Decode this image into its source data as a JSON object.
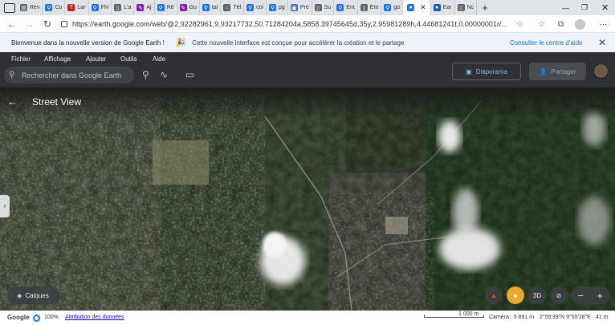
{
  "browser": {
    "tabs": [
      {
        "label": "Rev",
        "icon": "page-icon",
        "color": "#5f6368"
      },
      {
        "label": "Co",
        "icon": "search-icon",
        "color": "#1a73e8"
      },
      {
        "label": "Lar",
        "icon": "tf-icon",
        "color": "#c5221f"
      },
      {
        "label": "Fhi",
        "icon": "search-icon",
        "color": "#1a73e8"
      },
      {
        "label": "L'a",
        "icon": "doc-icon",
        "color": "#5f6368"
      },
      {
        "label": "Aj",
        "icon": "brush-icon",
        "color": "#7b1fa2"
      },
      {
        "label": "Ré",
        "icon": "search-icon",
        "color": "#1a73e8"
      },
      {
        "label": "Gu",
        "icon": "brush-icon",
        "color": "#7b1fa2"
      },
      {
        "label": "tal",
        "icon": "search-icon",
        "color": "#1a73e8"
      },
      {
        "label": "Tél",
        "icon": "download-icon",
        "color": "#5f6368"
      },
      {
        "label": "coi",
        "icon": "search-icon",
        "color": "#1a73e8"
      },
      {
        "label": "pg",
        "icon": "search-icon",
        "color": "#1a73e8"
      },
      {
        "label": "Pre",
        "icon": "chat-icon",
        "color": "#4a6fa5"
      },
      {
        "label": "Su",
        "icon": "doc-icon",
        "color": "#5f6368"
      },
      {
        "label": "Ent",
        "icon": "search-icon",
        "color": "#1a73e8"
      },
      {
        "label": "Ent",
        "icon": "doc-icon",
        "color": "#5f6368"
      },
      {
        "label": "go",
        "icon": "search-icon",
        "color": "#1a73e8"
      },
      {
        "label": "",
        "icon": "earth-icon",
        "color": "#1a73e8",
        "active": true
      },
      {
        "label": "Ear",
        "icon": "earth-icon",
        "color": "#1a5fb4"
      },
      {
        "label": "Nc",
        "icon": "doc-icon",
        "color": "#5f6368"
      }
    ],
    "url": "https://earth.google.com/web/@2.92282961,9.93217732,50.71284204a,5858.39745645d,35y,2.95981289h,4.44681241t,0.00000001r/..."
  },
  "banner": {
    "text1": "Bienvenue dans la nouvelle version de Google Earth !",
    "text2": "Cette nouvelle interface est conçue pour accélérer la création et le partage",
    "link": "Consulter le centre d'aide"
  },
  "menu": {
    "items": [
      "Fichier",
      "Affichage",
      "Ajouter",
      "Outils",
      "Aide"
    ],
    "search_placeholder": "Rechercher dans Google Earth",
    "diaporama": "Diaporama",
    "partager": "Partager"
  },
  "streetview": {
    "title": "Street View"
  },
  "controls": {
    "calques": "Calques",
    "btn3d": "3D"
  },
  "status": {
    "brand": "Google",
    "zoom_pct": "100%",
    "attribution": "Attribution des données",
    "scale": "1 000 m",
    "camera": "Caméra : 5 891 m",
    "coords": "2°55'39\"N 9°55'28\"E",
    "alt": "41 m"
  },
  "colors": {
    "accent": "#1a73e8",
    "banner": "#eef3fb",
    "menubar": "#2f3134"
  }
}
